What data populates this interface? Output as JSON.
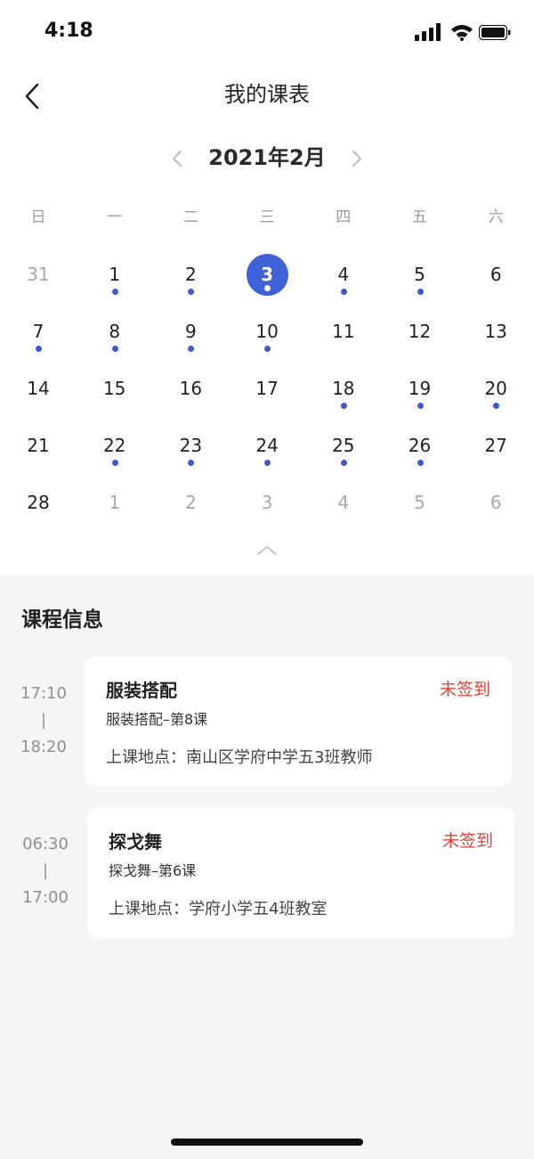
{
  "status_bar": {
    "time": "4:18"
  },
  "nav": {
    "title": "我的课表"
  },
  "calendar": {
    "month_label": "2021年2月",
    "weekdays": [
      "日",
      "一",
      "二",
      "三",
      "四",
      "五",
      "六"
    ],
    "weeks": [
      [
        {
          "d": "31",
          "other": true,
          "dot": false
        },
        {
          "d": "1",
          "other": false,
          "dot": true
        },
        {
          "d": "2",
          "other": false,
          "dot": true
        },
        {
          "d": "3",
          "other": false,
          "dot": true,
          "selected": true
        },
        {
          "d": "4",
          "other": false,
          "dot": true
        },
        {
          "d": "5",
          "other": false,
          "dot": true
        },
        {
          "d": "6",
          "other": false,
          "dot": false
        }
      ],
      [
        {
          "d": "7",
          "other": false,
          "dot": true
        },
        {
          "d": "8",
          "other": false,
          "dot": true
        },
        {
          "d": "9",
          "other": false,
          "dot": true
        },
        {
          "d": "10",
          "other": false,
          "dot": true
        },
        {
          "d": "11",
          "other": false,
          "dot": false
        },
        {
          "d": "12",
          "other": false,
          "dot": false
        },
        {
          "d": "13",
          "other": false,
          "dot": false
        }
      ],
      [
        {
          "d": "14",
          "other": false,
          "dot": false
        },
        {
          "d": "15",
          "other": false,
          "dot": false
        },
        {
          "d": "16",
          "other": false,
          "dot": false
        },
        {
          "d": "17",
          "other": false,
          "dot": false
        },
        {
          "d": "18",
          "other": false,
          "dot": true
        },
        {
          "d": "19",
          "other": false,
          "dot": true
        },
        {
          "d": "20",
          "other": false,
          "dot": true
        }
      ],
      [
        {
          "d": "21",
          "other": false,
          "dot": false
        },
        {
          "d": "22",
          "other": false,
          "dot": true
        },
        {
          "d": "23",
          "other": false,
          "dot": true
        },
        {
          "d": "24",
          "other": false,
          "dot": true
        },
        {
          "d": "25",
          "other": false,
          "dot": true
        },
        {
          "d": "26",
          "other": false,
          "dot": true
        },
        {
          "d": "27",
          "other": false,
          "dot": false
        }
      ],
      [
        {
          "d": "28",
          "other": false,
          "dot": false
        },
        {
          "d": "1",
          "other": true,
          "dot": false
        },
        {
          "d": "2",
          "other": true,
          "dot": false
        },
        {
          "d": "3",
          "other": true,
          "dot": false
        },
        {
          "d": "4",
          "other": true,
          "dot": false
        },
        {
          "d": "5",
          "other": true,
          "dot": false
        },
        {
          "d": "6",
          "other": true,
          "dot": false
        }
      ]
    ]
  },
  "courses_section": {
    "title": "课程信息",
    "items": [
      {
        "start": "17:10",
        "separator": "|",
        "end": "18:20",
        "name": "服装搭配",
        "status": "未签到",
        "lesson": "服装搭配–第8课",
        "location": "上课地点：南山区学府中学五3班教师"
      },
      {
        "start": "06:30",
        "separator": "|",
        "end": "17:00",
        "name": "探戈舞",
        "status": "未签到",
        "lesson": "探戈舞–第6课",
        "location": "上课地点：学府小学五4班教室"
      }
    ]
  },
  "colors": {
    "accent": "#3f62d8",
    "dot": "#3d5ad1",
    "status_red": "#d8443c",
    "background": "#f5f5f5"
  }
}
